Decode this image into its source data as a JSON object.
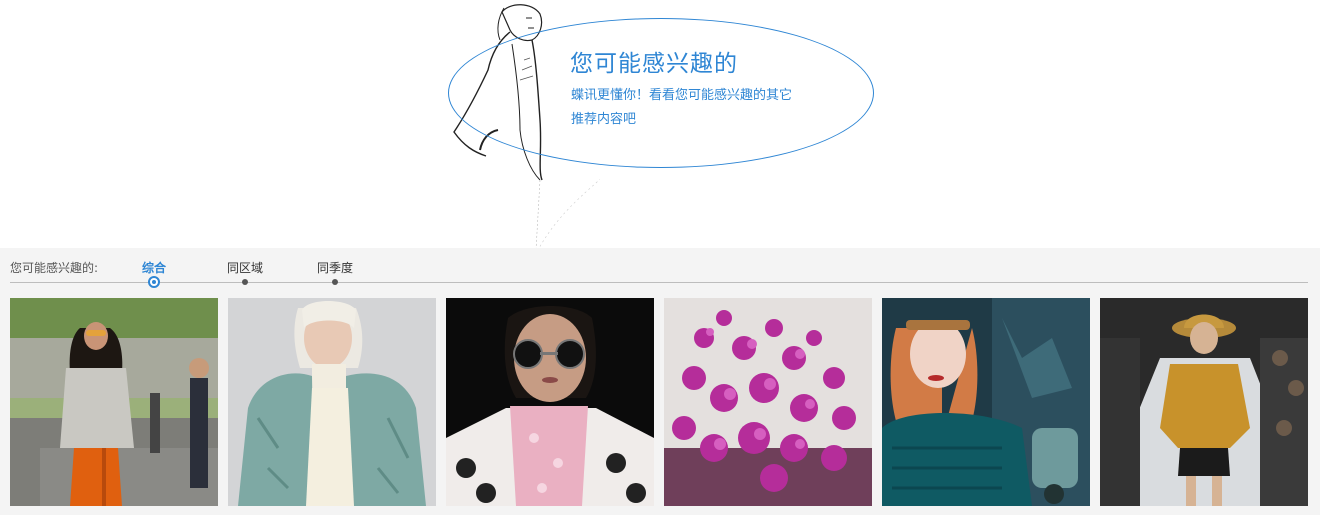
{
  "hero": {
    "title": "您可能感兴趣的",
    "subtitle_line1": "蝶讯更懂你！看看您可能感兴趣的其它",
    "subtitle_line2": "推荐内容吧",
    "illustration_icon": "fashion-sketch-figure"
  },
  "recommend": {
    "label": "您可能感兴趣的:",
    "tabs": [
      {
        "label": "综合",
        "active": true
      },
      {
        "label": "同区域",
        "active": false
      },
      {
        "label": "同季度",
        "active": false
      }
    ],
    "images": [
      {
        "alt": "street-style-grey-sweater-orange-pants"
      },
      {
        "alt": "teal-fur-jacket-white-knit"
      },
      {
        "alt": "round-sunglasses-pink-scarf"
      },
      {
        "alt": "purple-statice-flowers"
      },
      {
        "alt": "redhead-teal-knit-scooter"
      },
      {
        "alt": "runway-mustard-top-straw-hat"
      }
    ]
  },
  "colors": {
    "accent": "#2f86d4",
    "panel_bg": "#f4f4f4"
  }
}
